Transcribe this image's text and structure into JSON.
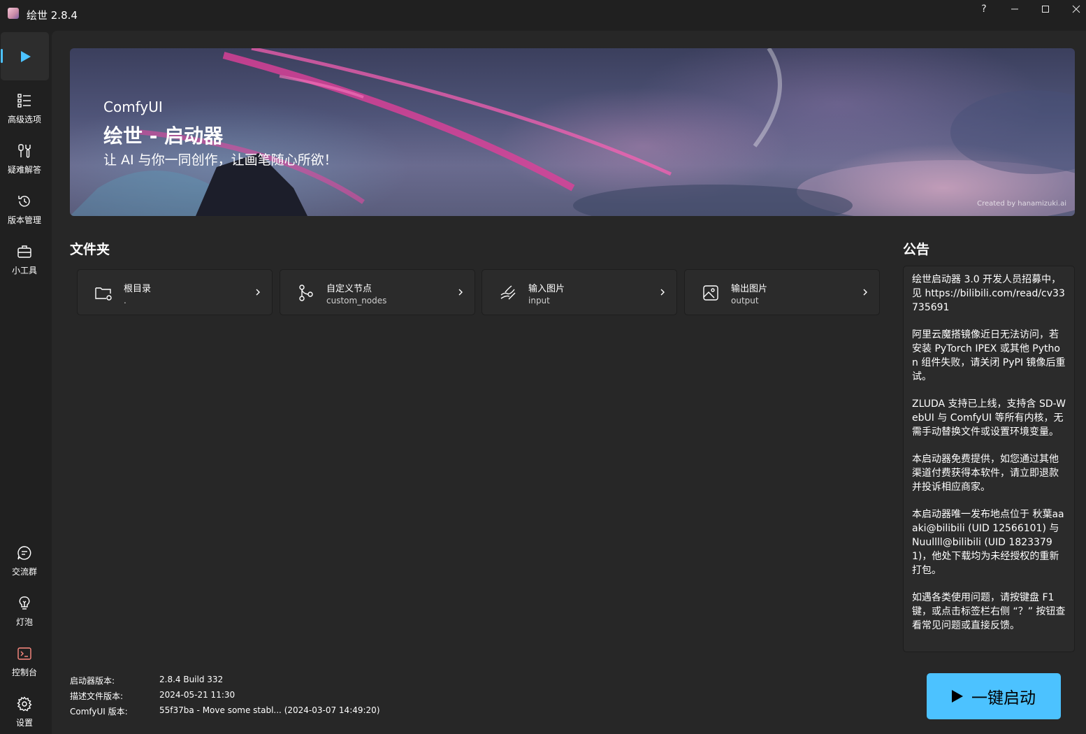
{
  "window": {
    "title": "绘世 2.8.4",
    "controls": {
      "help": "?",
      "minimize": "—",
      "maximize": "☐",
      "close": "✕"
    }
  },
  "sidebar": {
    "items": [
      {
        "id": "launch",
        "label": "",
        "icon": "play-icon"
      },
      {
        "id": "advanced",
        "label": "高级选项",
        "icon": "list-icon"
      },
      {
        "id": "troubleshoot",
        "label": "疑难解答",
        "icon": "tools-icon"
      },
      {
        "id": "versions",
        "label": "版本管理",
        "icon": "history-icon"
      },
      {
        "id": "tools",
        "label": "小工具",
        "icon": "toolbox-icon"
      }
    ],
    "bottom_items": [
      {
        "id": "community",
        "label": "交流群",
        "icon": "chat-icon"
      },
      {
        "id": "bulb",
        "label": "灯泡",
        "icon": "lightbulb-icon"
      },
      {
        "id": "console",
        "label": "控制台",
        "icon": "console-icon"
      },
      {
        "id": "settings",
        "label": "设置",
        "icon": "gear-icon"
      }
    ]
  },
  "banner": {
    "subtitle": "ComfyUI",
    "title": "绘世 - 启动器",
    "slogan": "让 AI 与你一同创作，让画笔随心所欲！",
    "credit": "Created by hanamizuki.ai"
  },
  "folders": {
    "title": "文件夹",
    "items": [
      {
        "name": "根目录",
        "path": ".",
        "icon": "folder-icon"
      },
      {
        "name": "自定义节点",
        "path": "custom_nodes",
        "icon": "branch-icon"
      },
      {
        "name": "输入图片",
        "path": "input",
        "icon": "input-image-icon"
      },
      {
        "name": "输出图片",
        "path": "output",
        "icon": "output-image-icon"
      }
    ]
  },
  "notice": {
    "title": "公告",
    "paragraphs": [
      "绘世启动器 3.0 开发人员招募中，见 https://bilibili.com/read/cv33735691",
      "阿里云魔搭镜像近日无法访问，若安装 PyTorch IPEX 或其他 Python 组件失败，请关闭 PyPI 镜像后重试。",
      "ZLUDA 支持已上线，支持含 SD-WebUI 与 ComfyUI 等所有内核，无需手动替换文件或设置环境变量。",
      "本启动器免费提供，如您通过其他渠道付费获得本软件，请立即退款并投诉相应商家。",
      "本启动器唯一发布地点位于 秋葉aaaki@bilibili (UID 12566101) 与 Nuullll@bilibili (UID 18233791)，他处下载均为未经授权的重新打包。",
      "如遇各类使用问题，请按键盘 F1 键，或点击标签栏右侧 “？” 按钮查看常见问题或直接反馈。"
    ]
  },
  "info": {
    "launcher_version_label": "启动器版本:",
    "launcher_version": "2.8.4 Build 332",
    "manifest_version_label": "描述文件版本:",
    "manifest_version": "2024-05-21 11:30",
    "comfyui_version_label": "ComfyUI 版本:",
    "comfyui_version": "55f37ba - Move some stabl... (2024-03-07 14:49:20)"
  },
  "launch_button": {
    "label": "一键启动"
  },
  "colors": {
    "accent": "#4cc2ff",
    "background": "#202020",
    "content": "#272727",
    "card": "#2b2b2b",
    "console_icon": "#ff8a80"
  }
}
